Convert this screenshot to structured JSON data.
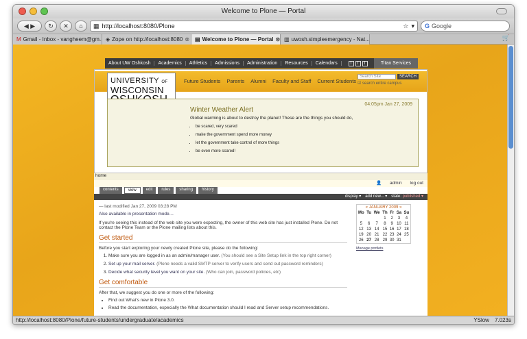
{
  "window": {
    "title": "Welcome to Plone — Portal"
  },
  "toolbar": {
    "url": "http://localhost:8080/Plone",
    "search_placeholder": "Google"
  },
  "tabs": [
    {
      "label": "Gmail - Inbox - vangheem@gm..."
    },
    {
      "label": "Zope on http://localhost:8080"
    },
    {
      "label": "Welcome to Plone — Portal"
    },
    {
      "label": "uwosh.simpleemergency - Nat..."
    }
  ],
  "topnav": {
    "items": [
      "About UW Oshkosh",
      "Academics",
      "Athletics",
      "Admissions",
      "Administration",
      "Resources",
      "Calendars"
    ],
    "sizes": [
      "T",
      "T",
      "T"
    ],
    "titan": "Titan Services"
  },
  "header": {
    "logo": {
      "line1": "UNIVERSITY",
      "of": "OF",
      "line2": "WISCONSIN",
      "line3": "OSHKOSH"
    },
    "nav": [
      "Future Students",
      "Parents",
      "Alumni",
      "Faculty and Staff",
      "Current Students"
    ],
    "search_placeholder": "Search Site",
    "search_button": "SEARCH",
    "search_option": "search entire campus"
  },
  "alert": {
    "time": "04:05pm Jan 27, 2009",
    "title": "Winter Weather Alert",
    "text": "Global warming is about to destroy the planet!  These are the things you should do,",
    "items": [
      "be scared, very scared",
      "make the government spend more money",
      "let the government take control of more things",
      "be even more scared!"
    ]
  },
  "breadcrumb": "home",
  "user": {
    "name": "admin",
    "logout": "log out"
  },
  "content_tabs": [
    "contents",
    "view",
    "edit",
    "rules",
    "sharing",
    "history"
  ],
  "actions": {
    "display": "display ▾",
    "add": "add new... ▾",
    "state_label": "state:",
    "state": "published ▾"
  },
  "main": {
    "modified": "— last modified Jan 27, 2009 03:28 PM",
    "presentation": "Also available in presentation mode…",
    "intro": "If you're seeing this instead of the web site you were expecting, the owner of this web site has just installed Plone. Do not contact the Plone Team or the Plone mailing lists about this.",
    "h_started": "Get started",
    "started_text": "Before you start exploring your newly created Plone site, please do the following:",
    "step1": "Make sure you are logged in as an admin/manager user.",
    "step1_hint": "(You should see a Site Setup link in the top right corner)",
    "step2": "Set up your mail server.",
    "step2_hint": "(Plone needs a valid SMTP server to verify users and send out password reminders)",
    "step3": "Decide what security level you want on your site.",
    "step3_hint": "(Who can join, password policies, etc)",
    "h_comfortable": "Get comfortable",
    "comfortable_text": "After that, we suggest you do one or more of the following:",
    "b1": "Find out What's new in Plone 3.0.",
    "b2": "Read the documentation, especially the What documentation should I read and Server setup recommendations."
  },
  "calendar": {
    "month": "JANUARY 2009",
    "prev": "«",
    "next": "»",
    "days": [
      "Mo",
      "Tu",
      "We",
      "Th",
      "Fr",
      "Sa",
      "Su"
    ],
    "weeks": [
      [
        "",
        "",
        "",
        "1",
        "2",
        "3",
        "4"
      ],
      [
        "5",
        "6",
        "7",
        "8",
        "9",
        "10",
        "11"
      ],
      [
        "12",
        "13",
        "14",
        "15",
        "16",
        "17",
        "18"
      ],
      [
        "19",
        "20",
        "21",
        "22",
        "23",
        "24",
        "25"
      ],
      [
        "26",
        "27",
        "28",
        "29",
        "30",
        "31",
        ""
      ]
    ],
    "manage": "Manage portlets"
  },
  "status": {
    "url": "http://localhost:8080/Plone/future-students/undergraduate/academics",
    "yslow": "YSlow",
    "time": "7.023s"
  },
  "colors": {
    "gold": "#f3b623",
    "dark": "#3b3b3b",
    "orange_heading": "#c05a10"
  }
}
